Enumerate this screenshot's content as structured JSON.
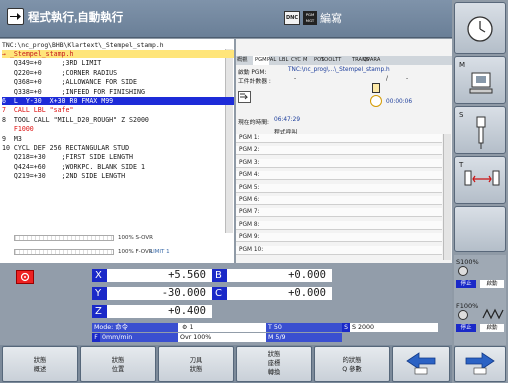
{
  "header": {
    "title": "程式執行,自動執行",
    "dnc_label": "DNC",
    "pgm_badge": "PGM MGT",
    "edit_label": "編寫"
  },
  "program": {
    "path": "TNC:\\nc_prog\\BHB\\Klartext\\_Stempel_stamp.h",
    "lines": [
      {
        "text": "→ _Stempel_stamp.h",
        "style": "cur"
      },
      {
        "text": "   Q349=+0     ;3RD LIMIT",
        "style": "normal"
      },
      {
        "text": "   Q220=+0     ;CORNER RADIUS",
        "style": "normal"
      },
      {
        "text": "   Q368=+0     ;ALLOWANCE FOR SIDE",
        "style": "normal"
      },
      {
        "text": "   Q338=+0     ;INFEED FOR FINISHING",
        "style": "normal"
      },
      {
        "text": "6  L  Y-30  X+30 R0 FMAX M99",
        "style": "sel"
      },
      {
        "text": "7  CALL LBL \"safe\"",
        "style": "red"
      },
      {
        "text": "8  TOOL CALL \"MILL_D20_ROUGH\" Z S2000",
        "style": "normal"
      },
      {
        "text": "   F1000",
        "style": "red"
      },
      {
        "text": "9  M3",
        "style": "normal"
      },
      {
        "text": "10 CYCL DEF 256 RECTANGULAR STUD",
        "style": "normal"
      },
      {
        "text": "   Q218=+30    ;FIRST SIDE LENGTH",
        "style": "normal"
      },
      {
        "text": "   Q424=+60    ;WORKPC. BLANK SIDE 1",
        "style": "normal"
      },
      {
        "text": "   Q219=+30    ;2ND SIDE LENGTH",
        "style": "normal"
      }
    ],
    "s_ovr_label": "100% S-OVR",
    "f_ovr_label": "100% F-OVR",
    "limit_label": "LIMIT 1"
  },
  "status": {
    "tabs": [
      "概觀",
      "PGM",
      "PAL",
      "LBL",
      "CYC",
      "M",
      "POS",
      "TOOL",
      "TT",
      "TRANS",
      "QPARA"
    ],
    "active_pgm_label": "啟動 PGM:",
    "active_pgm_value": "TNC:\\nc_prog\\...\\_Stempel_stamp.h",
    "workpiece_count_label": "工件計數器 :",
    "workpiece_count_value": "-",
    "workpiece_count_sep": "/",
    "workpiece_count_total": "-",
    "timer": "00:00:06",
    "current_time_label": "現在的時間:",
    "current_time": "06:47:29",
    "program_call_label": "程式呼叫",
    "pgm_rows": [
      "PGM 1:",
      "PGM 2:",
      "PGM 3:",
      "PGM 4:",
      "PGM 5:",
      "PGM 6:",
      "PGM 7:",
      "PGM 8:",
      "PGM 9:",
      "PGM 10:"
    ]
  },
  "positions": {
    "x_label": "X",
    "x_value": "+5.560",
    "y_label": "Y",
    "y_value": "-30.000",
    "z_label": "Z",
    "z_value": "+0.400",
    "b_label": "B",
    "b_value": "+0.000",
    "c_label": "C",
    "c_value": "+0.000",
    "mode_label": "Mode: 命令",
    "spindle_label": "1",
    "tool_label": "T 50",
    "speed_label": "S 2000",
    "feed_label": "0mm/min",
    "ovr_label": "Ovr 100%",
    "m_label": "M 5/9"
  },
  "right": {
    "s_ovr": "S100%",
    "f_ovr": "F100%",
    "stop_label": "停止",
    "stop_label2": "停止",
    "start_label": "啟動",
    "start_label2": "啟動",
    "m_label": "M",
    "s_label": "S",
    "t_label": "T"
  },
  "softkeys": [
    {
      "line1": "狀態",
      "line2": "概述"
    },
    {
      "line1": "狀態",
      "line2": "位置"
    },
    {
      "line1": "刀具",
      "line2": "狀態"
    },
    {
      "line1": "狀態",
      "line2": "座標",
      "line3": "轉換"
    },
    {
      "line1": "的狀態",
      "line2": "Q 參數"
    }
  ],
  "colors": {
    "highlight_current": "#ffe57a",
    "highlight_selected": "#1d2bd8",
    "axis_label_bg": "#1a29c8",
    "alarm_red": "#e22"
  }
}
